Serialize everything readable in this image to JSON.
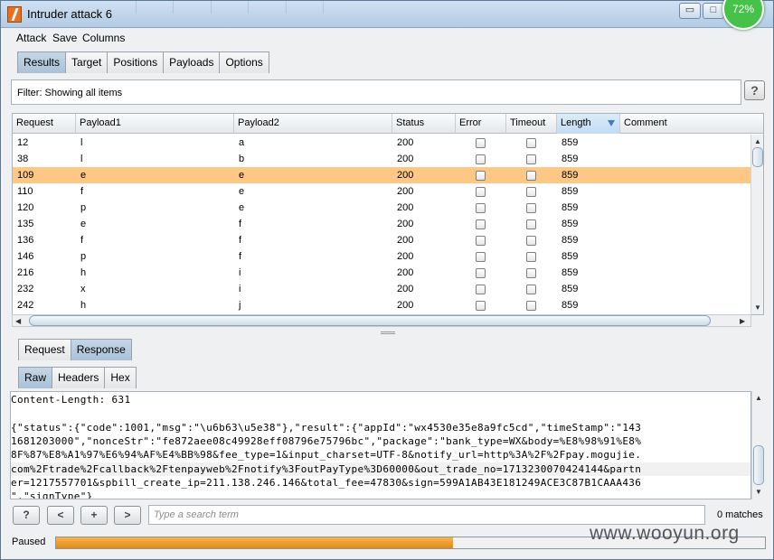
{
  "window": {
    "title": "Intruder attack 6",
    "badge": "72%",
    "min_glyph": "▭",
    "max_glyph": "□"
  },
  "menubar": [
    "Attack",
    "Save",
    "Columns"
  ],
  "top_tabs": {
    "items": [
      "Results",
      "Target",
      "Positions",
      "Payloads",
      "Options"
    ],
    "active": "Results"
  },
  "filter": {
    "text": "Filter:  Showing all items",
    "help": "?"
  },
  "table": {
    "columns": [
      "Request",
      "Payload1",
      "Payload2",
      "Status",
      "Error",
      "Timeout",
      "Length",
      "Comment"
    ],
    "sorted_column": "Length",
    "selected_index": 2,
    "rows": [
      {
        "request": "12",
        "payload1": "l",
        "payload2": "a",
        "status": "200",
        "error": false,
        "timeout": false,
        "length": "859",
        "comment": ""
      },
      {
        "request": "38",
        "payload1": "l",
        "payload2": "b",
        "status": "200",
        "error": false,
        "timeout": false,
        "length": "859",
        "comment": ""
      },
      {
        "request": "109",
        "payload1": "e",
        "payload2": "e",
        "status": "200",
        "error": false,
        "timeout": false,
        "length": "859",
        "comment": ""
      },
      {
        "request": "110",
        "payload1": "f",
        "payload2": "e",
        "status": "200",
        "error": false,
        "timeout": false,
        "length": "859",
        "comment": ""
      },
      {
        "request": "120",
        "payload1": "p",
        "payload2": "e",
        "status": "200",
        "error": false,
        "timeout": false,
        "length": "859",
        "comment": ""
      },
      {
        "request": "135",
        "payload1": "e",
        "payload2": "f",
        "status": "200",
        "error": false,
        "timeout": false,
        "length": "859",
        "comment": ""
      },
      {
        "request": "136",
        "payload1": "f",
        "payload2": "f",
        "status": "200",
        "error": false,
        "timeout": false,
        "length": "859",
        "comment": ""
      },
      {
        "request": "146",
        "payload1": "p",
        "payload2": "f",
        "status": "200",
        "error": false,
        "timeout": false,
        "length": "859",
        "comment": ""
      },
      {
        "request": "216",
        "payload1": "h",
        "payload2": "i",
        "status": "200",
        "error": false,
        "timeout": false,
        "length": "859",
        "comment": ""
      },
      {
        "request": "232",
        "payload1": "x",
        "payload2": "i",
        "status": "200",
        "error": false,
        "timeout": false,
        "length": "859",
        "comment": ""
      },
      {
        "request": "242",
        "payload1": "h",
        "payload2": "j",
        "status": "200",
        "error": false,
        "timeout": false,
        "length": "859",
        "comment": ""
      }
    ]
  },
  "detail_tabs": {
    "items": [
      "Request",
      "Response"
    ],
    "active": "Response"
  },
  "view_tabs": {
    "items": [
      "Raw",
      "Headers",
      "Hex"
    ],
    "active": "Raw"
  },
  "response": {
    "lines": [
      "Content-Length: 631",
      "",
      "{\"status\":{\"code\":1001,\"msg\":\"\\u6b63\\u5e38\"},\"result\":{\"appId\":\"wx4530e35e8a9fc5cd\",\"timeStamp\":\"143",
      "1681203000\",\"nonceStr\":\"fe872aee08c49928eff08796e75796bc\",\"package\":\"bank_type=WX&body=%E8%98%91%E8%",
      "8F%87%E8%A1%97%E6%94%AF%E4%BB%98&fee_type=1&input_charset=UTF-8&notify_url=http%3A%2F%2Fpay.mogujie.",
      "com%2Ftrade%2Fcallback%2Ftenpayweb%2Fnotify%3FoutPayType%3D60000&out_trade_no=1713230070424144&partn",
      "er=1217557701&spbill_create_ip=211.138.246.146&total_fee=47830&sign=599A1AB43E181249ACE3C87B1CAAA436",
      "\",\"signType\"}"
    ],
    "highlight_line": 5
  },
  "search": {
    "help": "?",
    "prev": "<",
    "add": "+",
    "next": ">",
    "placeholder": "Type a search term",
    "matches": "0 matches"
  },
  "status": {
    "text": "Paused",
    "progress": 0.56
  },
  "watermark": "www.wooyun.org"
}
